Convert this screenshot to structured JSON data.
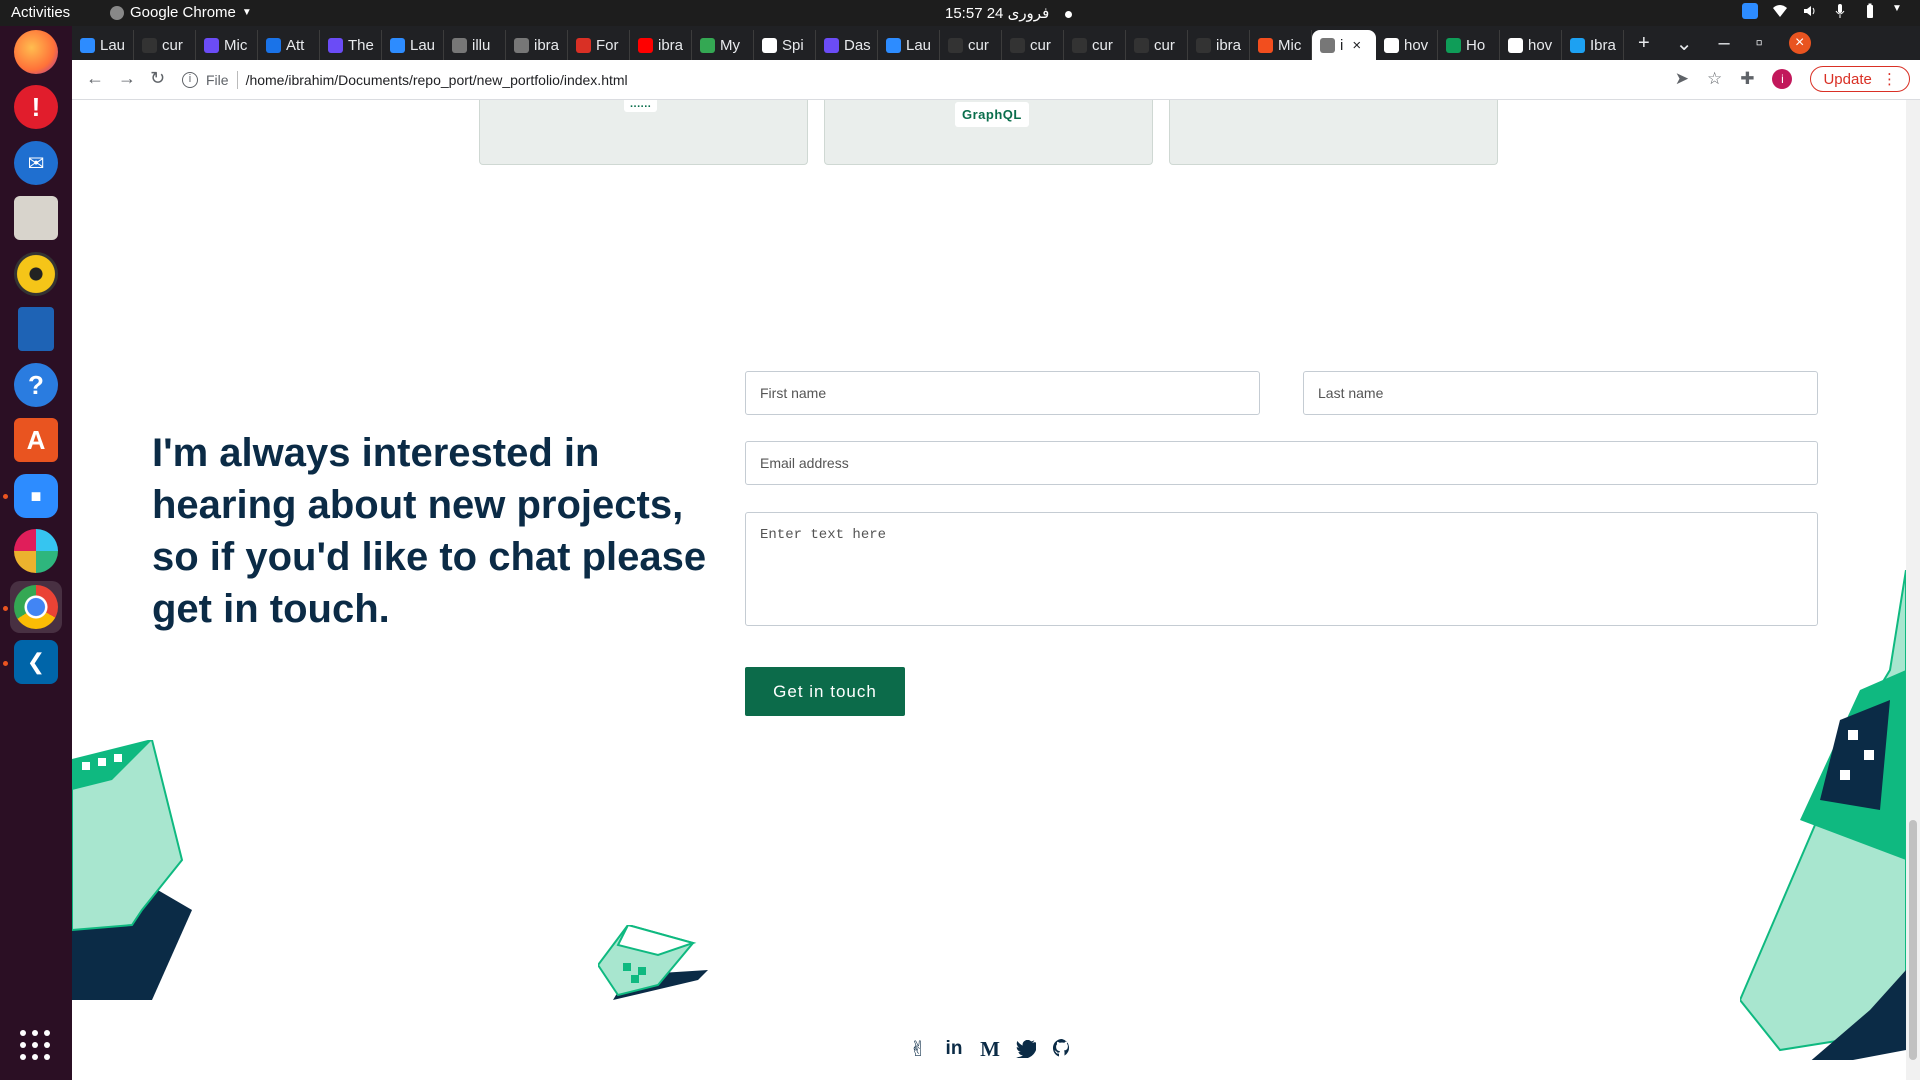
{
  "system": {
    "activities": "Activities",
    "app_name": "Google Chrome",
    "clock": "15:57  فروری 24"
  },
  "dock": {
    "items": [
      "firefox-icon",
      "error-report-icon",
      "thunderbird-icon",
      "files-icon",
      "rhythmbox-icon",
      "writer-icon",
      "help-icon",
      "software-icon",
      "zoom-icon",
      "slack-icon",
      "chrome-icon",
      "vscode-icon"
    ]
  },
  "browser": {
    "tabs": [
      {
        "label": "Lau",
        "color": "#2d8cff"
      },
      {
        "label": "cur",
        "color": "#333333"
      },
      {
        "label": "Mic",
        "color": "#6b4cf6"
      },
      {
        "label": "Att",
        "color": "#1a73e8"
      },
      {
        "label": "The",
        "color": "#6b4cf6"
      },
      {
        "label": "Lau",
        "color": "#2d8cff"
      },
      {
        "label": "illu",
        "color": "#777777"
      },
      {
        "label": "ibra",
        "color": "#777777"
      },
      {
        "label": "For",
        "color": "#d93025"
      },
      {
        "label": "ibra",
        "color": "#ff0000"
      },
      {
        "label": "My",
        "color": "#34a853"
      },
      {
        "label": "Spi",
        "color": "#ffffff"
      },
      {
        "label": "Das",
        "color": "#6b4cf6"
      },
      {
        "label": "Lau",
        "color": "#2d8cff"
      },
      {
        "label": "cur",
        "color": "#333333"
      },
      {
        "label": "cur",
        "color": "#333333"
      },
      {
        "label": "cur",
        "color": "#333333"
      },
      {
        "label": "cur",
        "color": "#333333"
      },
      {
        "label": "ibra",
        "color": "#333333"
      },
      {
        "label": "Mic",
        "color": "#f24e1e"
      },
      {
        "label": "i",
        "color": "#777777",
        "active": true
      },
      {
        "label": "hov",
        "color": "#ffffff"
      },
      {
        "label": "Ho",
        "color": "#0f9d58"
      },
      {
        "label": "hov",
        "color": "#ffffff"
      },
      {
        "label": "Ibra",
        "color": "#1da1f2"
      }
    ],
    "file_label": "File",
    "url": "/home/ibrahim/Documents/repo_port/new_portfolio/index.html",
    "update_label": "Update",
    "avatar_letter": "i"
  },
  "page": {
    "cards": {
      "chip_label": "GraphQL",
      "top_chip": "......"
    },
    "headline": "I'm always interested in hearing about new projects, so if you'd like to chat please get in touch.",
    "form": {
      "first_name_placeholder": "First name",
      "last_name_placeholder": "Last name",
      "email_placeholder": "Email address",
      "message_placeholder": "Enter text here",
      "submit_label": "Get in touch"
    },
    "socials": [
      "angellist-icon",
      "linkedin-icon",
      "medium-icon",
      "twitter-icon",
      "github-icon"
    ],
    "colors": {
      "accent": "#0c6b4a",
      "heading": "#0b2b46",
      "deco_green": "#0fb980",
      "deco_light": "#a8e6cf",
      "deco_navy": "#0b2b46"
    }
  }
}
